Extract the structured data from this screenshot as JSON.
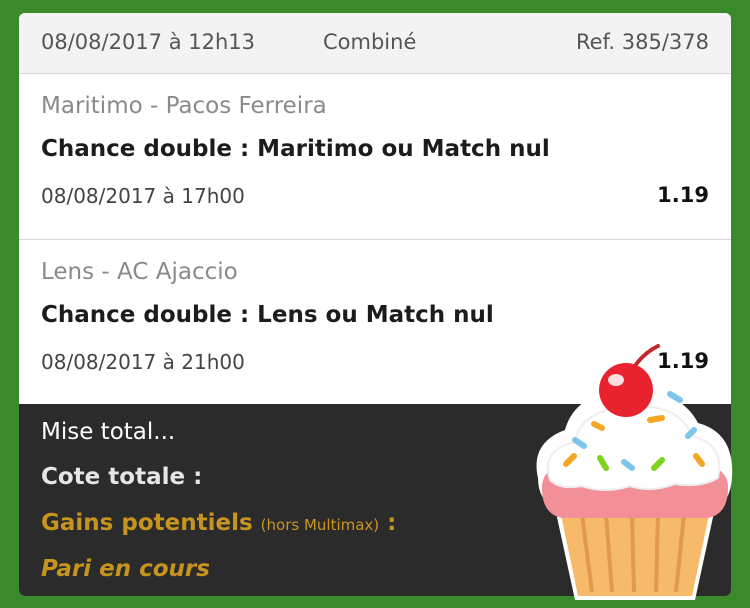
{
  "header": {
    "date": "08/08/2017 à 12h13",
    "type": "Combiné",
    "ref": "Ref. 385/378"
  },
  "bets": [
    {
      "match": "Maritimo - Pacos Ferreira",
      "choice": "Chance double : Maritimo ou Match nul",
      "datetime": "08/08/2017 à 17h00",
      "odd": "1.19"
    },
    {
      "match": "Lens - AC Ajaccio",
      "choice": "Chance double : Lens ou Match nul",
      "datetime": "08/08/2017 à 21h00",
      "odd": "1.19"
    }
  ],
  "footer": {
    "mise": "Mise total...",
    "cote": "Cote totale :",
    "gains": "Gains potentiels",
    "gains_note": "(hors Multimax)",
    "gains_colon": " :",
    "status": "Pari en cours"
  },
  "colors": {
    "background": "#3a8a2c",
    "panel_dark": "#2b2b2b",
    "gold": "#c89420"
  },
  "decoration": "cupcake-sticker"
}
